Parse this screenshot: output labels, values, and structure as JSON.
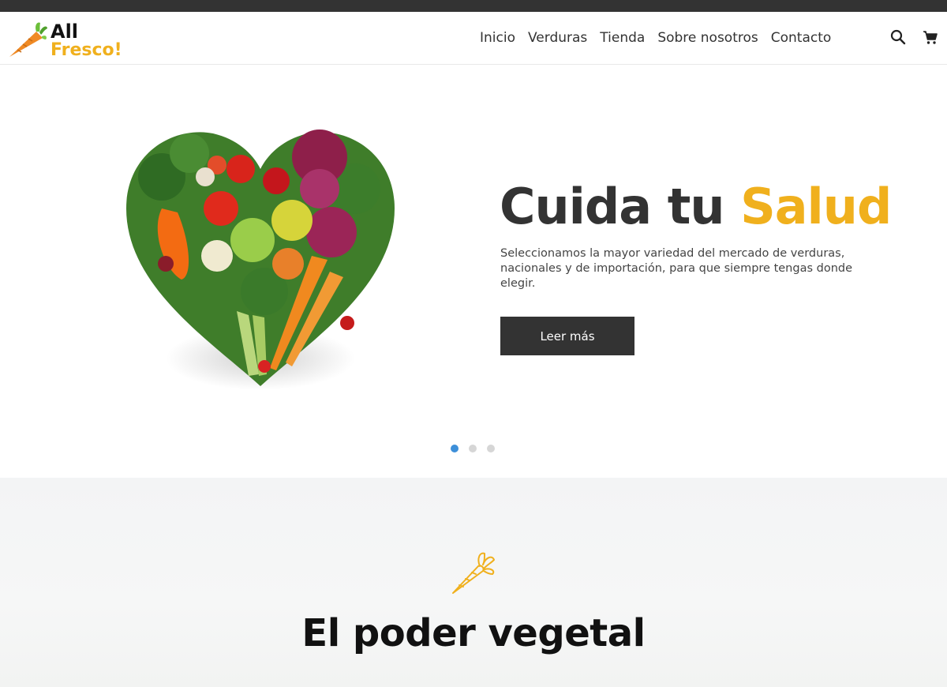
{
  "brand": {
    "line1": "All",
    "line2": "Fresco!",
    "accent_color": "#f0b01d"
  },
  "nav": {
    "items": [
      {
        "label": "Inicio"
      },
      {
        "label": "Verduras"
      },
      {
        "label": "Tienda"
      },
      {
        "label": "Sobre nosotros"
      },
      {
        "label": "Contacto"
      }
    ],
    "icons": [
      "search-icon",
      "cart-icon"
    ]
  },
  "hero": {
    "title_main": "Cuida tu ",
    "title_accent": "Salud",
    "description": "Seleccionamos la mayor variedad del mercado de verduras, nacionales y de importación, para que siempre tengas donde elegir.",
    "cta_label": "Leer más",
    "image": "vegetable-heart",
    "slides": 3,
    "active_slide": 1,
    "dot_active_color": "#3d8fd9"
  },
  "section": {
    "icon": "carrot-outline-icon",
    "title": "El poder vegetal"
  }
}
